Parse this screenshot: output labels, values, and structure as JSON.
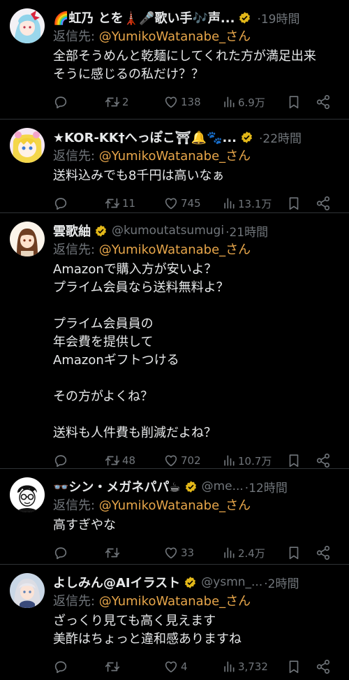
{
  "reply_prefix": "返信先: ",
  "more_glyph": "···",
  "tweets": [
    {
      "name": "🌈虹乃 とを🗼🎤歌い手🎶声...",
      "handle": "",
      "time": "·19時間",
      "mention": "@YumikoWatanabe_さん",
      "text": "全部そうめんと乾麺にしてくれた方が満足出来\nそうに感じるの私だけ？？",
      "retweets": "2",
      "likes": "138",
      "views": "6.9万"
    },
    {
      "name": "★KOR-KK†へっぽこ⛩🔔🐾...",
      "handle": "",
      "time": "·22時間",
      "mention": "@YumikoWatanabe_さん",
      "text": "送料込みでも8千円は高いなぁ",
      "retweets": "11",
      "likes": "745",
      "views": "13.1万"
    },
    {
      "name": "雲歌紬",
      "handle": "@kumoutatsumugi",
      "time": "·21時間",
      "mention": "@YumikoWatanabe_さん",
      "text": "Amazonで購入方が安いよ？\nプライム会員なら送料無料よ？\n\nプライム会員員の\n年会費を提供して\nAmazonギフトつける\n\nその方がよくね？\n\n送料も人件費も削減だよね？",
      "retweets": "48",
      "likes": "702",
      "views": "10.7万"
    },
    {
      "name": "👓シン・メガネパパ☕",
      "handle": "@me...",
      "time": "·12時間",
      "mention": "@YumikoWatanabe_さん",
      "text": "高すぎやな",
      "retweets": "",
      "likes": "33",
      "views": "2.4万"
    },
    {
      "name": "よしみん@AIイラスト",
      "handle": "@ysmn_...",
      "time": "·2時間",
      "mention": "@YumikoWatanabe_さん",
      "text": "ざっくり見ても高く見えます\n美酢はちょっと違和感ありますね",
      "retweets": "",
      "likes": "4",
      "views": "3,732"
    }
  ],
  "colors": {
    "background": "#000000",
    "text": "#e7e9ea",
    "muted": "#71767b",
    "mention": "#e7a64a",
    "verified_badge": "#e2b719",
    "divider": "#2f3336"
  },
  "icons": [
    "verified-badge-icon",
    "reply-icon",
    "retweet-icon",
    "like-icon",
    "views-icon",
    "bookmark-icon",
    "share-icon"
  ]
}
